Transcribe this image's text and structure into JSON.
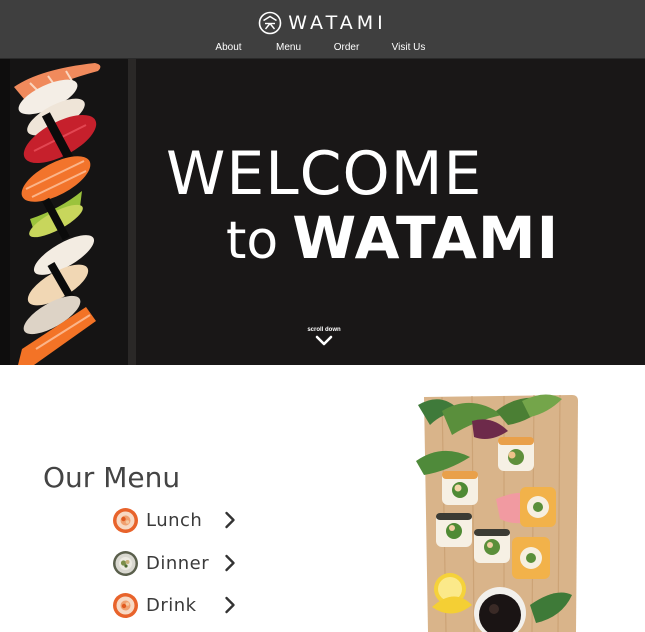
{
  "header": {
    "brand": "WATAMI",
    "logo_icon": "watami-logo-icon",
    "nav": [
      {
        "label": "About"
      },
      {
        "label": "Menu"
      },
      {
        "label": "Order"
      },
      {
        "label": "Visit Us"
      }
    ]
  },
  "hero": {
    "welcome": "WELCOME",
    "to": "to",
    "brand": "WATAMI",
    "scroll_label": "scroll down",
    "scroll_icon": "chevron-down-icon"
  },
  "menu": {
    "title": "Our Menu",
    "items": [
      {
        "label": "Lunch",
        "icon": "sushi-roll-icon"
      },
      {
        "label": "Dinner",
        "icon": "sushi-roll-icon"
      },
      {
        "label": "Drink",
        "icon": "sushi-roll-icon"
      }
    ]
  },
  "colors": {
    "header_bg": "#3f3f3f",
    "hero_bg": "#191717",
    "text_dark": "#444444",
    "salmon": "#e8632b"
  }
}
